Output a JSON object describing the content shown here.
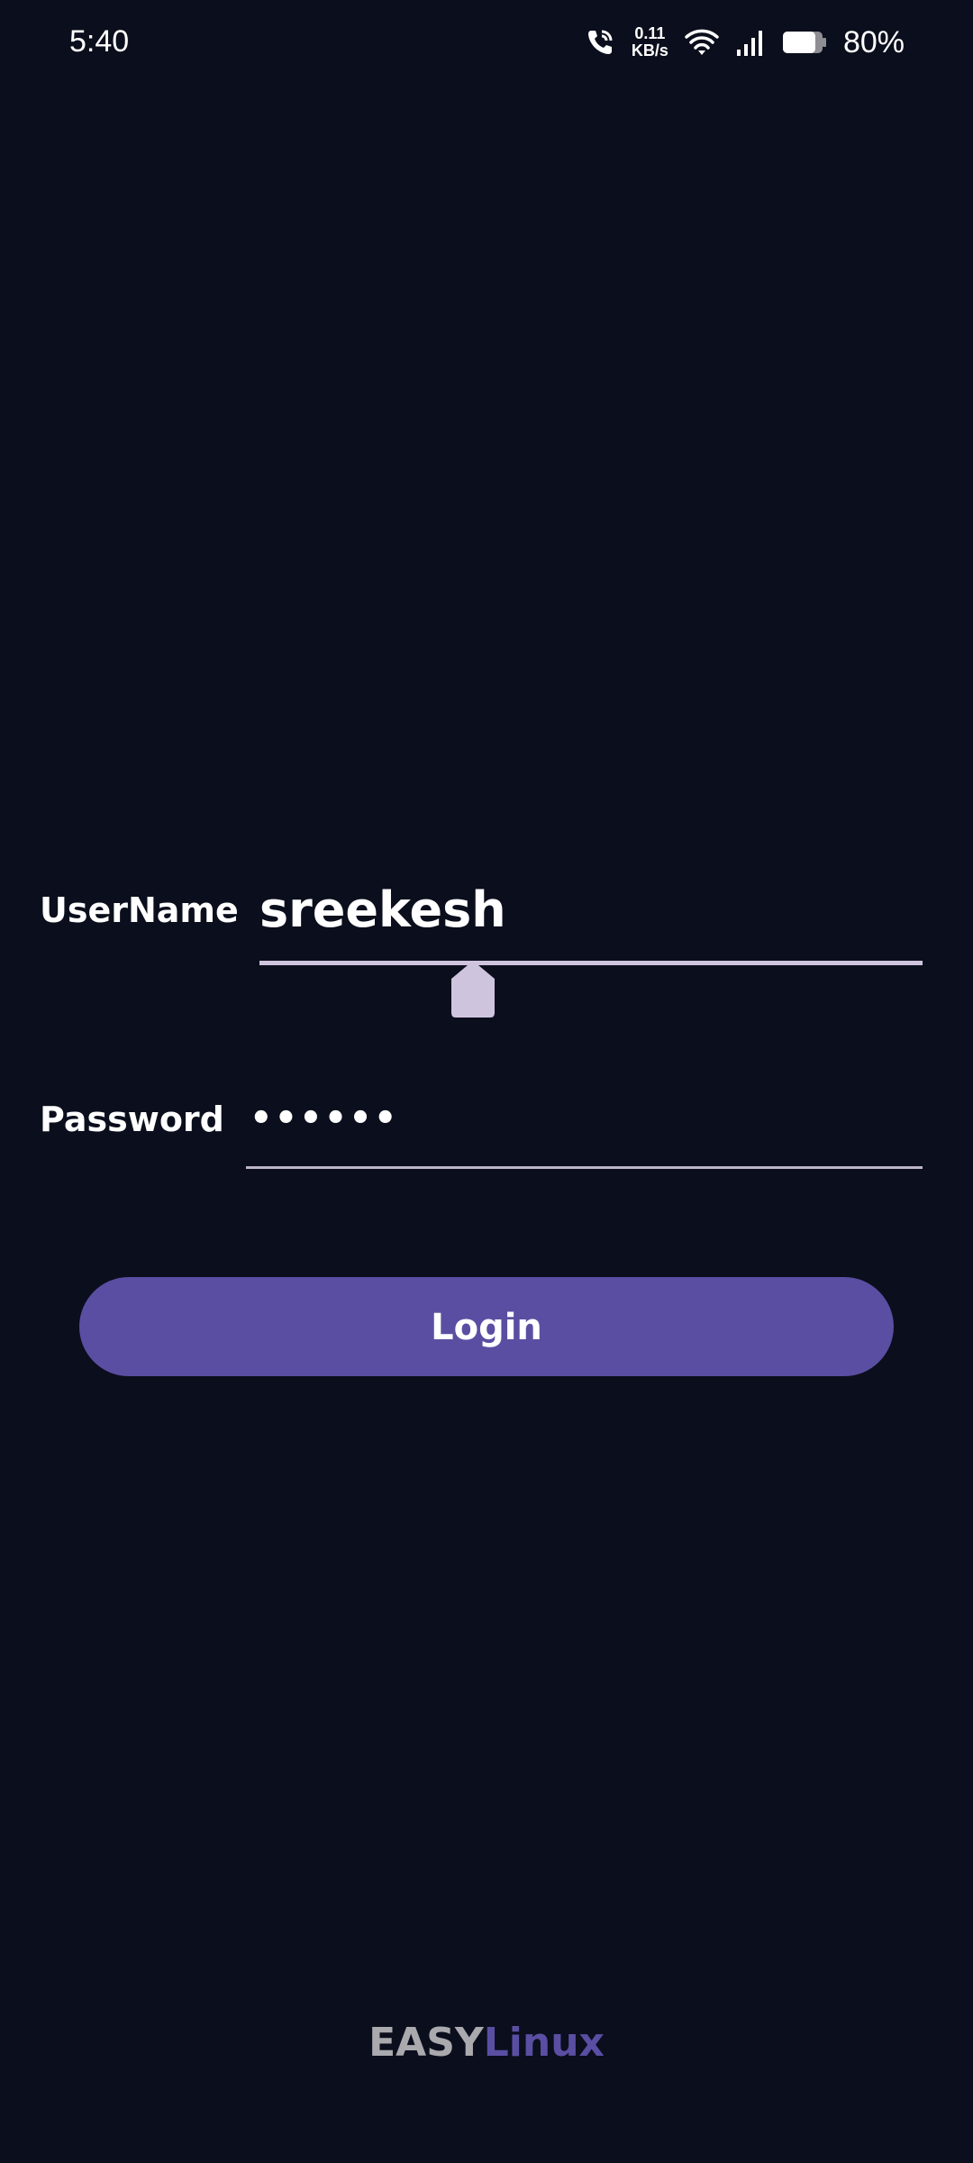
{
  "status_bar": {
    "time": "5:40",
    "net_speed_value": "0.11",
    "net_speed_unit": "KB/s",
    "battery_percent": "80%",
    "icons": [
      "wifi-calling-icon",
      "wifi-icon",
      "signal-icon",
      "battery-icon"
    ]
  },
  "login_form": {
    "username_label": "UserName",
    "username_value": "sreekesh",
    "password_label": "Password",
    "password_value": "••••••",
    "login_label": "Login"
  },
  "footer": {
    "logo_part_1": "EASY",
    "logo_part_2": "Linux"
  },
  "colors": {
    "background": "#0b0e1c",
    "accent": "#5a4ea3",
    "field_underline": "#cfc4de",
    "logo_gray": "#a9a9ae"
  }
}
